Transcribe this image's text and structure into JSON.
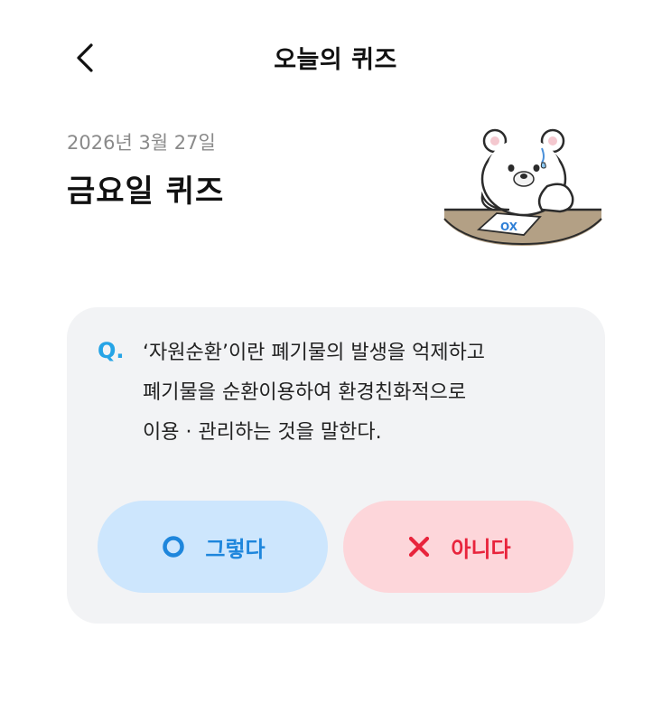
{
  "header": {
    "title": "오늘의 퀴즈",
    "back_icon": "chevron-left-icon"
  },
  "quiz": {
    "date": "2026년 3월 27일",
    "title": "금요일 퀴즈",
    "mascot_sheet_text": "OX"
  },
  "question": {
    "prefix": "Q.",
    "lines": [
      "‘자원순환’이란 폐기물의 발생을 억제하고",
      "폐기물을 순환이용하여 환경친화적으로",
      "이용 · 관리하는 것을 말한다."
    ]
  },
  "answers": {
    "yes": {
      "label": "그렇다",
      "icon": "circle-o-icon",
      "color": "#1e86dc",
      "bg": "#cde6fd"
    },
    "no": {
      "label": "아니다",
      "icon": "x-mark-icon",
      "color": "#e8243c",
      "bg": "#fdd6da"
    }
  },
  "colors": {
    "accent": "#26a4e6",
    "card_bg": "#f2f3f5"
  }
}
